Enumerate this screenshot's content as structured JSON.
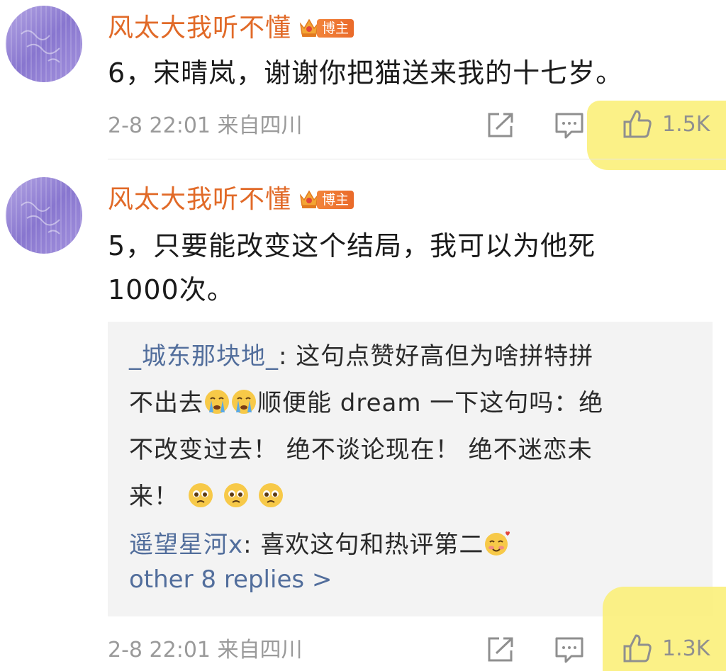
{
  "comments": [
    {
      "username": "风太大我听不懂",
      "badge": "博主",
      "text": "6，宋晴岚，谢谢你把猫送来我的十七岁。",
      "meta": "2-8 22:01 来自四川",
      "likes": "1.5K"
    },
    {
      "username": "风太大我听不懂",
      "badge": "博主",
      "text_line1": "5，只要能改变这个结局，我可以为他死",
      "text_line2": "1000次。",
      "meta": "2-8 22:01 来自四川",
      "likes": "1.3K",
      "replies": {
        "reply1": {
          "user": "_城东那块地_",
          "line1_text": ": 这句点赞好高但为啥拼特拼",
          "line2_pre": "不出去",
          "line2_post": "顺便能 dream 一下这句吗：绝",
          "line3": "不改变过去！ 绝不谈论现在！ 绝不迷恋未",
          "line4_pre": "来！ "
        },
        "reply2": {
          "user": "遥望星河x",
          "text": ": 喜欢这句和热评第二"
        },
        "more_label": "other 8 replies >"
      }
    }
  ],
  "icons": {
    "share": "share-icon",
    "comment": "comment-icon",
    "like": "thumbs-up-icon",
    "crown": "crown-icon",
    "emoji_cry": "crying-face-icon",
    "emoji_pleading": "pleading-face-icon",
    "emoji_love": "smiling-face-with-hearts-icon"
  },
  "colors": {
    "username": "#e16a28",
    "badge": "#ea6a2a",
    "reply_user": "#526e9c",
    "meta": "#9a9a9a",
    "highlight": "#fbf07a"
  }
}
